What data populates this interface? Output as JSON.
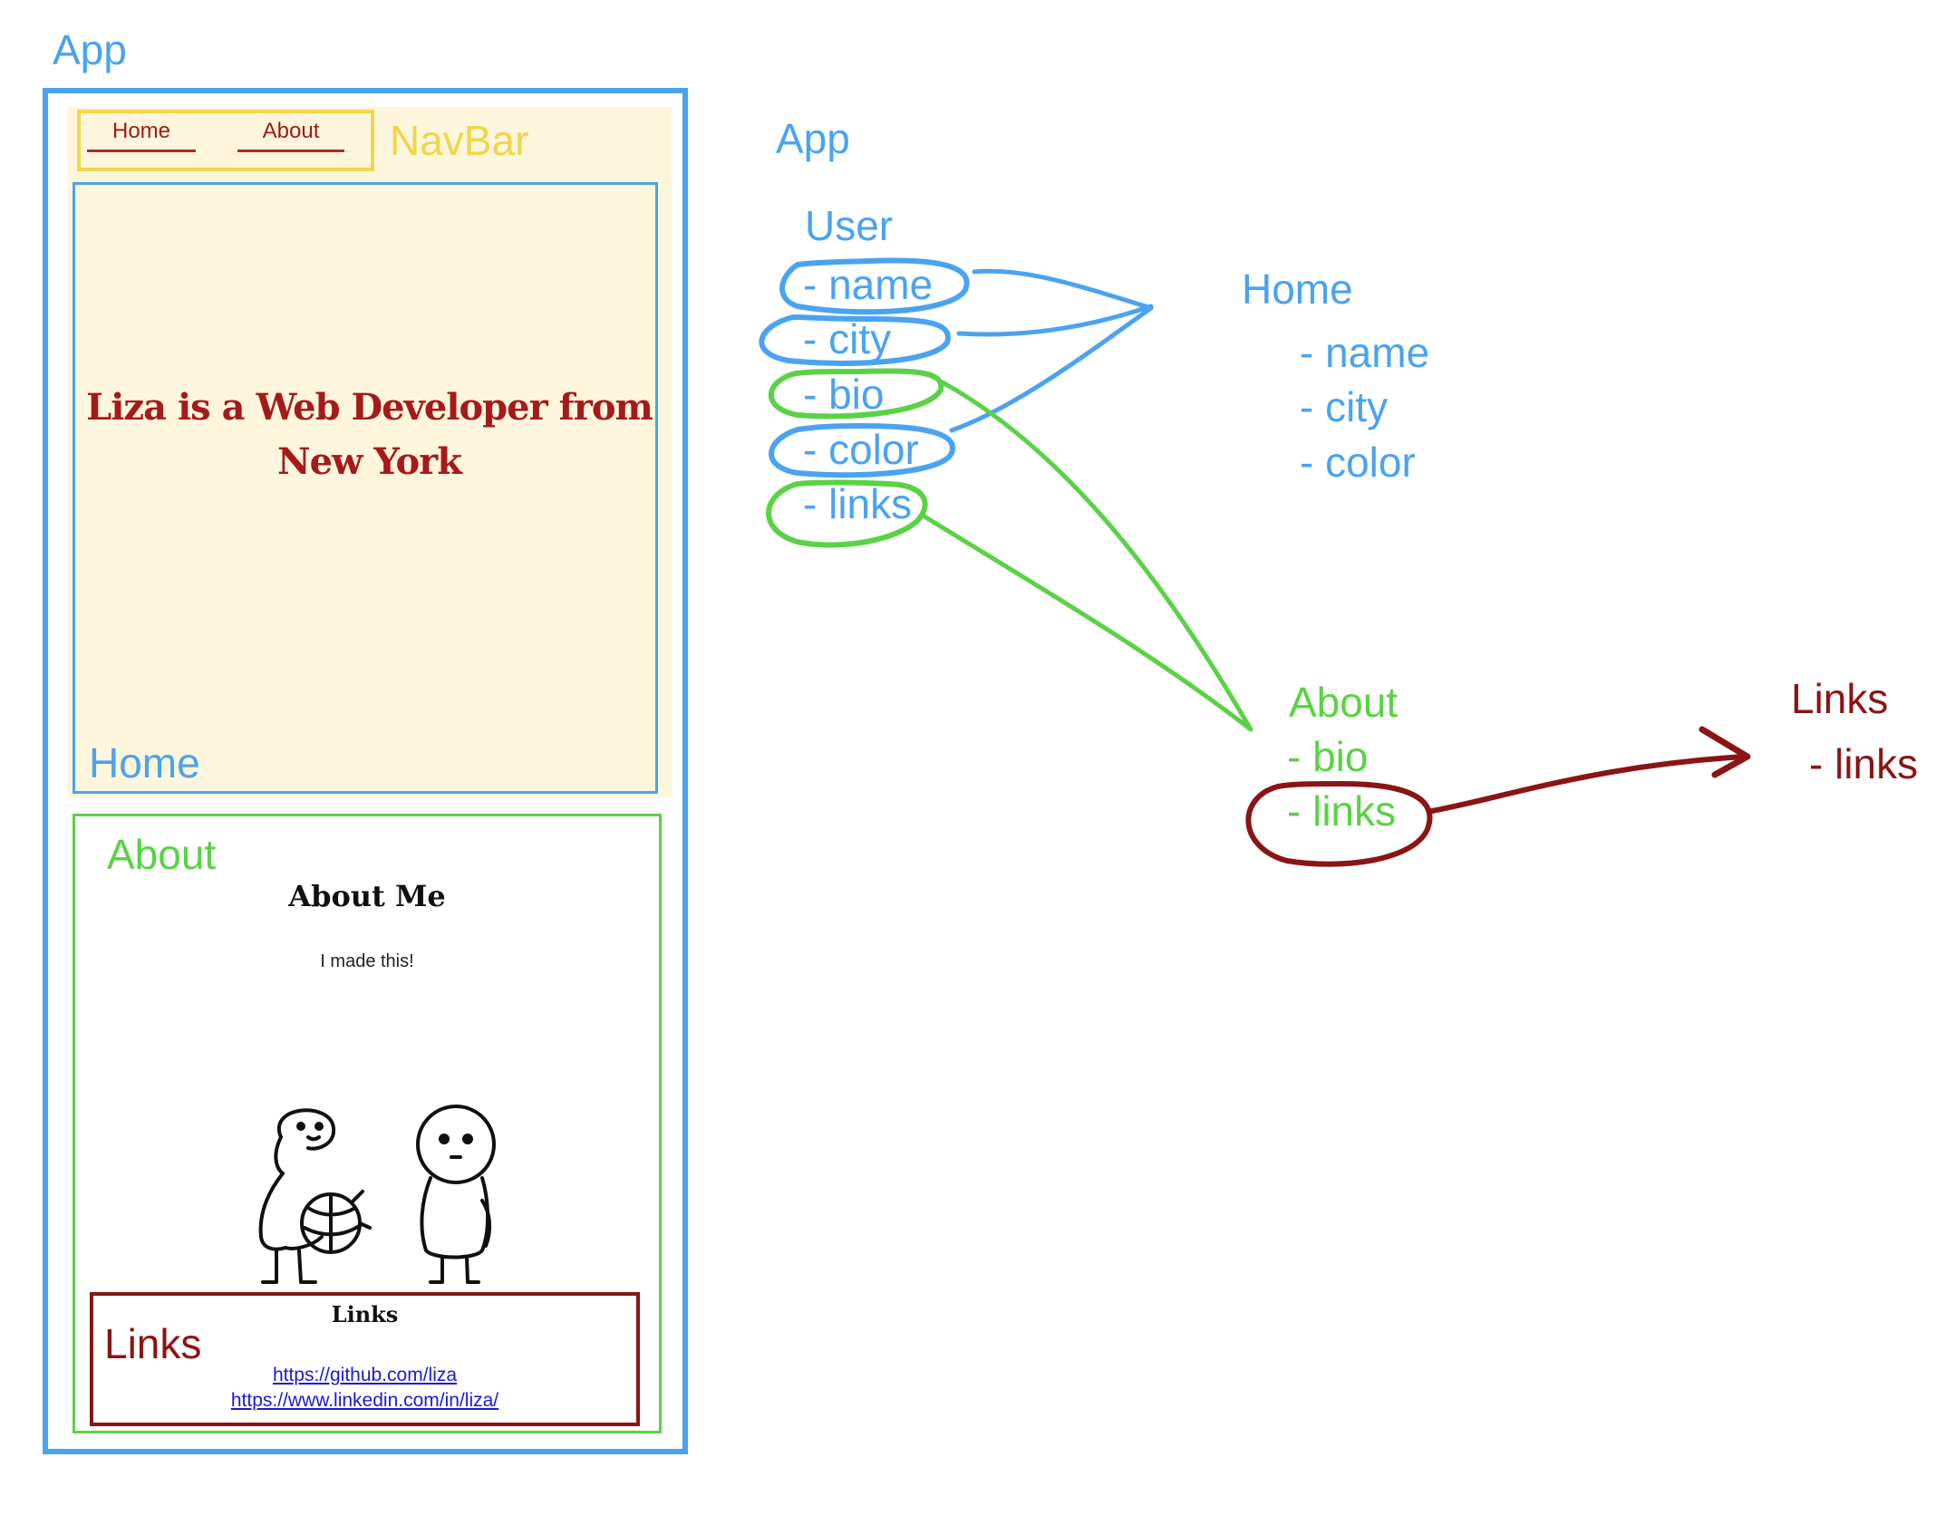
{
  "labels": {
    "app": "App",
    "navbar": "NavBar",
    "home": "Home",
    "about": "About",
    "links": "Links"
  },
  "mockup": {
    "nav": {
      "home_link": "Home",
      "about_link": "About"
    },
    "hero": "Liza is a Web Developer from New York",
    "about": {
      "heading": "About Me",
      "text": "I made this!"
    },
    "links": {
      "heading": "Links",
      "urls": [
        "https://github.com/liza",
        "https://www.linkedin.com/in/liza/"
      ]
    }
  },
  "tree": {
    "app": "App",
    "user": {
      "title": "User",
      "props": [
        "- name",
        "- city",
        "- bio",
        "- color",
        "- links"
      ]
    },
    "home": {
      "title": "Home",
      "props": [
        "- name",
        "- city",
        "- color"
      ]
    },
    "about": {
      "title": "About",
      "props": [
        "- bio",
        "- links"
      ]
    },
    "links": {
      "title": "Links",
      "props": [
        "- links"
      ]
    }
  },
  "colors": {
    "app_blue": "#4aa3f0",
    "navbar_yellow": "#f0d64a",
    "about_green": "#5ad245",
    "links_darkred": "#8b1414",
    "mockup_background": "#fdf6dc"
  },
  "icons": [
    "two-stick-figures-illustration",
    "arrow-right-icon"
  ]
}
